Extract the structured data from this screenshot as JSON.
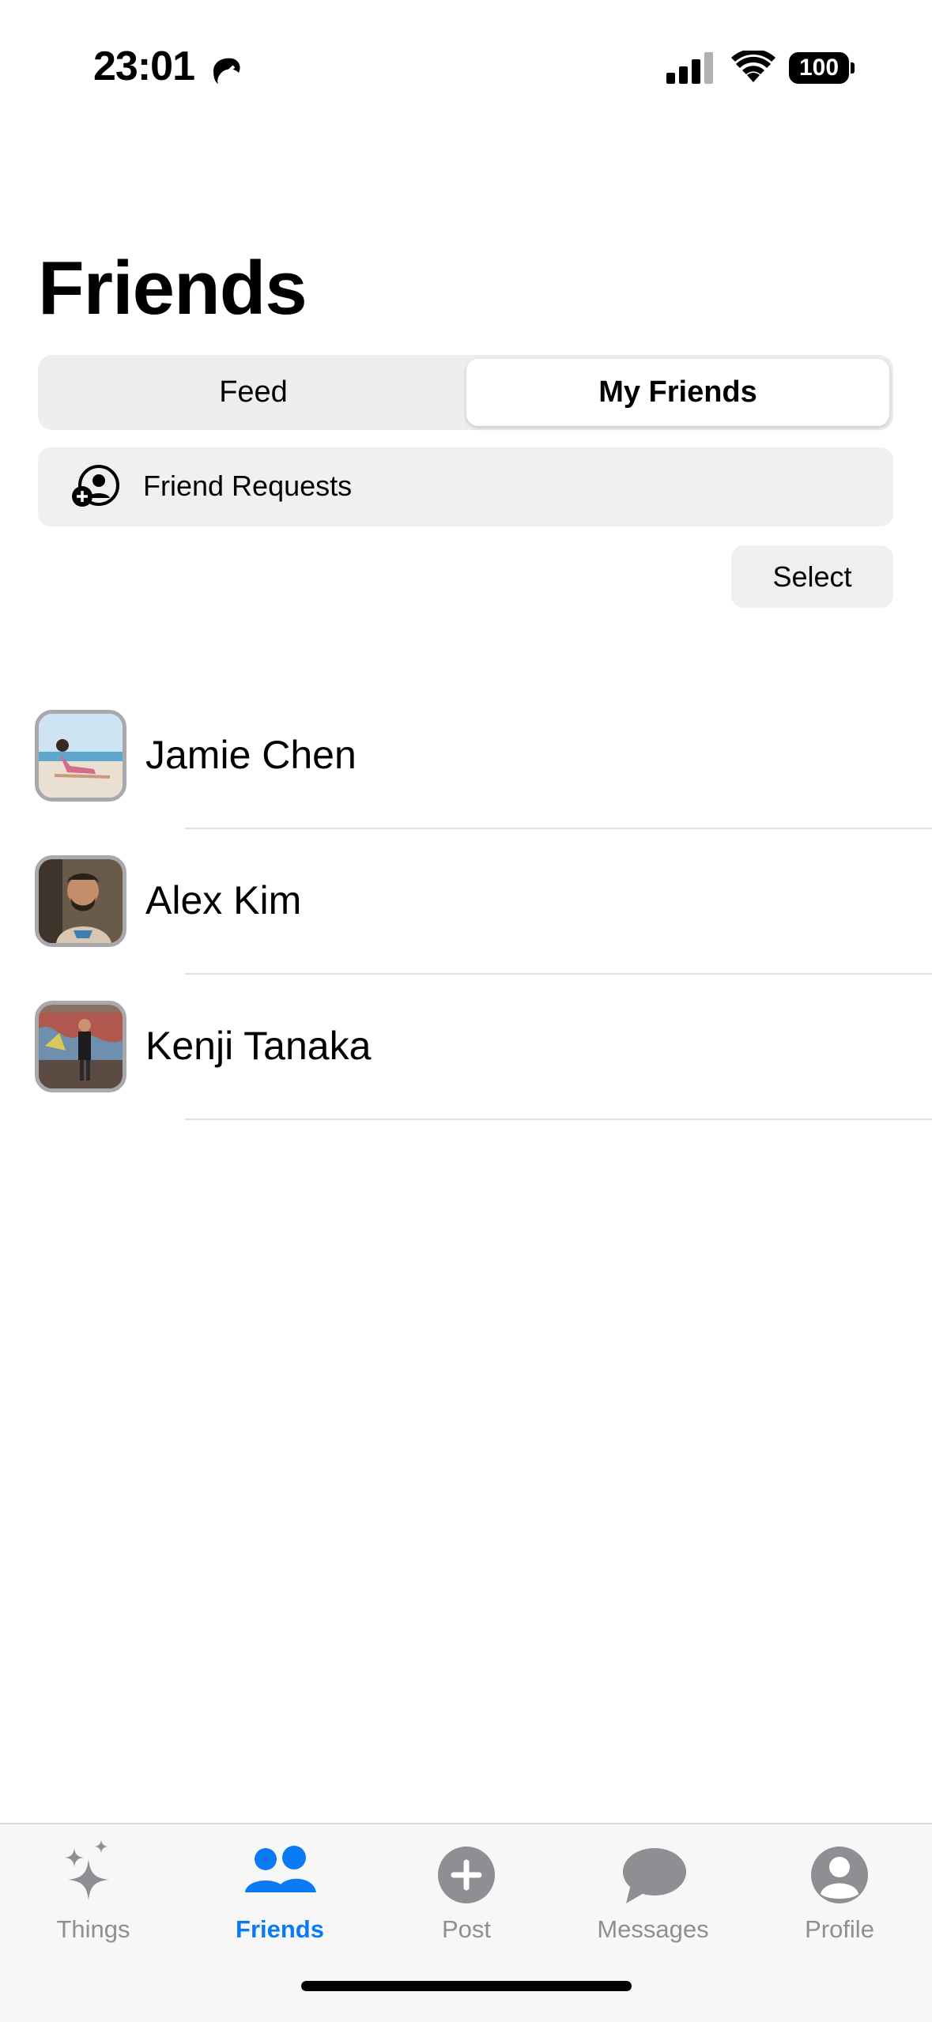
{
  "status_bar": {
    "time": "23:01",
    "battery": "100"
  },
  "page": {
    "title": "Friends"
  },
  "segments": {
    "feed": "Feed",
    "my_friends": "My Friends",
    "selected": "My Friends"
  },
  "requests": {
    "label": "Friend Requests"
  },
  "actions": {
    "select": "Select"
  },
  "friends": [
    {
      "name": "Jamie Chen"
    },
    {
      "name": "Alex Kim"
    },
    {
      "name": "Kenji Tanaka"
    }
  ],
  "tabs": {
    "things": "Things",
    "friends": "Friends",
    "post": "Post",
    "messages": "Messages",
    "profile": "Profile",
    "active": "Friends"
  },
  "colors": {
    "accent": "#0a7bf5",
    "inactive": "#8e8e93"
  }
}
